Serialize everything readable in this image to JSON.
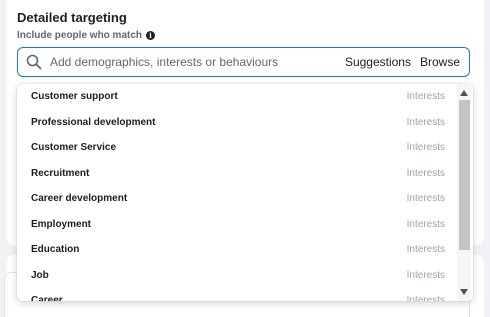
{
  "section": {
    "title": "Detailed targeting",
    "sub_label": "Include people who match"
  },
  "search": {
    "placeholder": "Add demographics, interests or behaviours",
    "suggestions_label": "Suggestions",
    "browse_label": "Browse"
  },
  "results": [
    {
      "name": "Customer support",
      "type": "Interests"
    },
    {
      "name": "Professional development",
      "type": "Interests"
    },
    {
      "name": "Customer Service",
      "type": "Interests"
    },
    {
      "name": "Recruitment",
      "type": "Interests"
    },
    {
      "name": "Career development",
      "type": "Interests"
    },
    {
      "name": "Employment",
      "type": "Interests"
    },
    {
      "name": "Education",
      "type": "Interests"
    },
    {
      "name": "Job",
      "type": "Interests"
    },
    {
      "name": "Career",
      "type": "Interests"
    }
  ],
  "icons": {
    "info": "info-icon",
    "search": "search-icon",
    "scroll_up": "scroll-up-arrow-icon",
    "scroll_down": "scroll-down-arrow-icon"
  },
  "colors": {
    "accent": "#1b74e4",
    "background": "#f0f2f5",
    "muted_text": "#a0a3a7"
  }
}
